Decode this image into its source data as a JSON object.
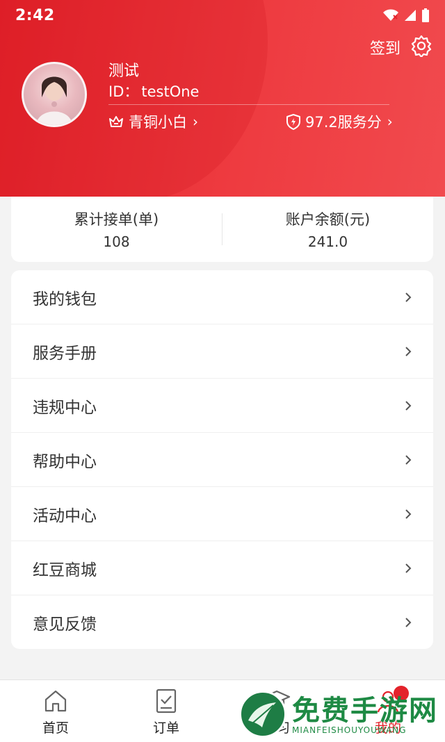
{
  "status_bar": {
    "time": "2:42"
  },
  "header": {
    "checkin_label": "签到",
    "user_name": "测试",
    "user_id_label": "ID：",
    "user_id": "testOne",
    "level_label": "青铜小白",
    "score_label": "97.2服务分"
  },
  "stats": [
    {
      "label": "累计接单(单)",
      "value": "108"
    },
    {
      "label": "账户余额(元)",
      "value": "241.0"
    }
  ],
  "menu": [
    {
      "label": "我的钱包"
    },
    {
      "label": "服务手册"
    },
    {
      "label": "违规中心"
    },
    {
      "label": "帮助中心"
    },
    {
      "label": "活动中心"
    },
    {
      "label": "红豆商城"
    },
    {
      "label": "意见反馈"
    }
  ],
  "tabbar": [
    {
      "label": "首页",
      "icon": "home-icon"
    },
    {
      "label": "订单",
      "icon": "order-icon"
    },
    {
      "label": "学习",
      "icon": "study-icon"
    },
    {
      "label": "我的",
      "icon": "profile-icon",
      "active": true
    }
  ],
  "watermark": {
    "title": "免费手游网",
    "subtitle": "MIANFEISHOUYOUWANG"
  },
  "colors": {
    "brand_red": "#e3232b",
    "watermark_green": "#1e8a44"
  }
}
